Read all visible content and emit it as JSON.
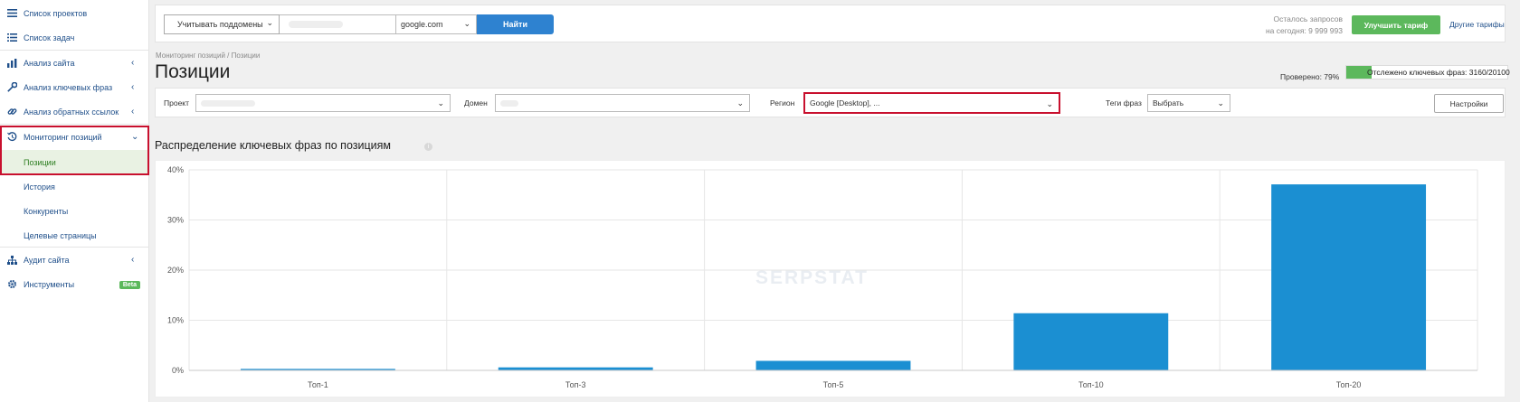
{
  "sidebar": {
    "items": [
      {
        "label": "Список проектов",
        "icon": "menu-icon"
      },
      {
        "label": "Список задач",
        "icon": "list-icon"
      },
      {
        "label": "Анализ сайта",
        "icon": "chart-icon"
      },
      {
        "label": "Анализ ключевых фраз",
        "icon": "key-icon"
      },
      {
        "label": "Анализ обратных ссылок",
        "icon": "link-icon"
      },
      {
        "label": "Мониторинг позиций",
        "icon": "history-icon"
      },
      {
        "label": "Аудит сайта",
        "icon": "sitemap-icon"
      },
      {
        "label": "Инструменты",
        "icon": "gear-icon"
      }
    ],
    "submenu": [
      "Позиции",
      "История",
      "Конкуренты",
      "Целевые страницы"
    ],
    "beta_label": "Beta"
  },
  "topbar": {
    "subdomains_label": "Учитывать поддомены",
    "search_placeholder": "",
    "engine": "google.com",
    "find_label": "Найти",
    "quota_line1": "Осталось запросов",
    "quota_line2": "на сегодня: 9 999 993",
    "upgrade_label": "Улучшить тариф",
    "other_plans_label": "Другие тарифы"
  },
  "page": {
    "breadcrumb": "Мониторинг позиций / Позиции",
    "title": "Позиции",
    "checked": "Проверено: 79%",
    "tracked": "Отслежено ключевых фраз: 3160/20100",
    "tracked_progress": 0.157
  },
  "filters": {
    "project_label": "Проект",
    "domain_label": "Домен",
    "region_label": "Регион",
    "region_value": "Google [Desktop], ...",
    "tags_label": "Теги фраз",
    "tags_value": "Выбрать",
    "settings_label": "Настройки"
  },
  "section": {
    "title": "Распределение ключевых фраз по позициям"
  },
  "watermark": "SERPSTAT",
  "colors": {
    "bar": "#1b8fd2",
    "accent_green": "#5cb85c",
    "highlight": "#c8102e",
    "link": "#1f4f8a"
  },
  "chart_data": {
    "type": "bar",
    "categories": [
      "Топ-1",
      "Топ-3",
      "Топ-5",
      "Топ-10",
      "Топ-20"
    ],
    "values": [
      0.3,
      0.6,
      1.9,
      11.4,
      37.1
    ],
    "yticks": [
      "0%",
      "10%",
      "20%",
      "30%",
      "40%"
    ],
    "ylim": [
      0,
      40
    ],
    "grid": true
  }
}
